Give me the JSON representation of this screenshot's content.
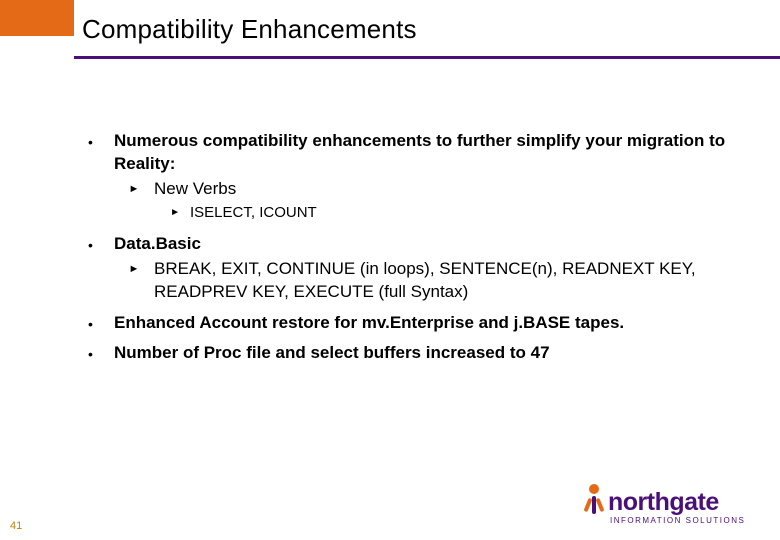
{
  "slide": {
    "title": "Compatibility Enhancements",
    "page_number": "41"
  },
  "bullets": {
    "b1": {
      "text": "Numerous compatibility enhancements to further simplify your migration to Reality:",
      "sub1": {
        "text": "New Verbs"
      },
      "sub1a": {
        "text": "ISELECT, ICOUNT"
      }
    },
    "b2": {
      "text": "Data.Basic",
      "sub1": {
        "text": "BREAK, EXIT, CONTINUE (in loops), SENTENCE(n), READNEXT KEY, READPREV KEY, EXECUTE (full Syntax)"
      }
    },
    "b3": {
      "text": "Enhanced Account restore for mv.Enterprise and j.BASE tapes."
    },
    "b4": {
      "text": "Number of Proc file and select buffers increased to 47"
    }
  },
  "logo": {
    "name": "northgate",
    "sub": "INFORMATION SOLUTIONS"
  }
}
